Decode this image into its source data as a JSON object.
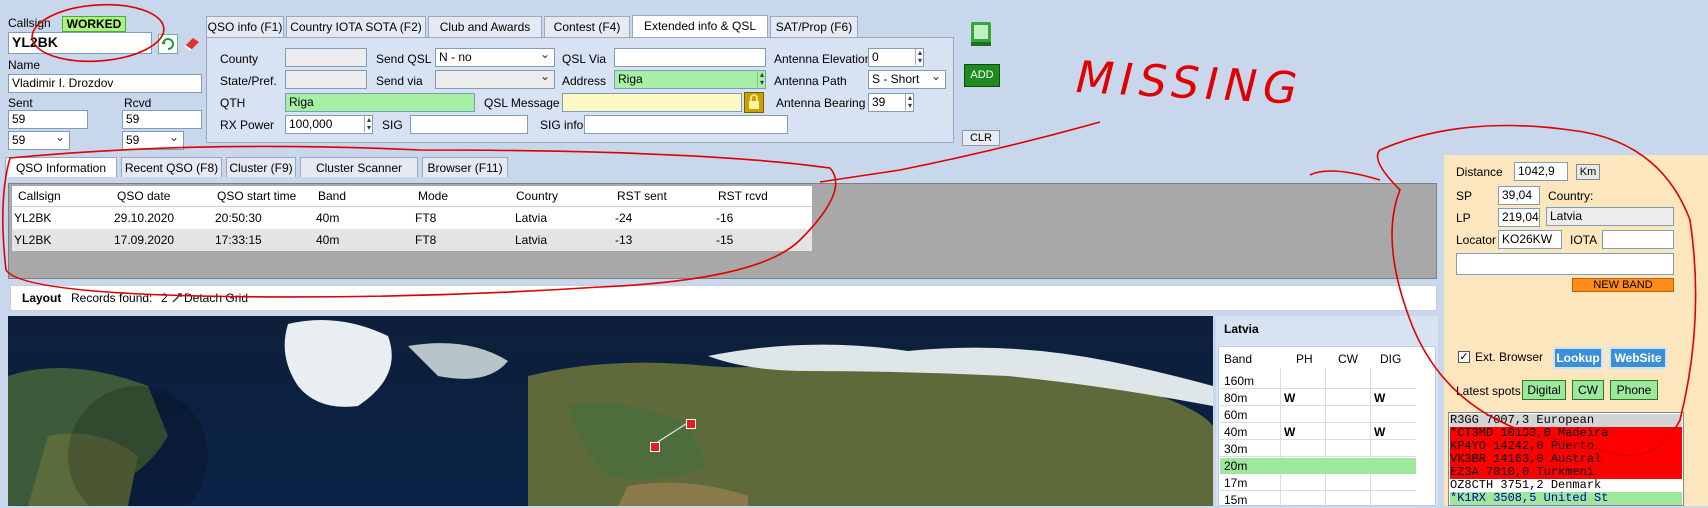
{
  "callsign_panel": {
    "callsign_label": "Callsign",
    "worked_badge": "WORKED",
    "callsign_value": "YL2BK",
    "name_label": "Name",
    "name_value": "Vladimir I. Drozdov",
    "sent_label": "Sent",
    "rcvd_label": "Rcvd",
    "sent_value": "59",
    "rcvd_value": "59",
    "sent_combo": "59",
    "rcvd_combo": "59"
  },
  "top_tabs": [
    "QSO info (F1)",
    "Country IOTA SOTA (F2)",
    "Club and Awards (F3)",
    "Contest (F4)",
    "Extended info & QSL (F5)",
    "SAT/Prop (F6)"
  ],
  "ext_form": {
    "county_label": "County",
    "state_label": "State/Pref.",
    "qth_label": "QTH",
    "qth_value": "Riga",
    "rx_power_label": "RX Power",
    "rx_power_value": "100,000",
    "send_qsl_label": "Send QSL",
    "send_qsl_value": "N - no",
    "send_via_label": "Send via",
    "qsl_message_label": "QSL Message",
    "sig_label": "SIG",
    "qsl_via_label": "QSL Via",
    "address_label": "Address",
    "address_value": "Riga",
    "sig_info_label": "SIG info",
    "antenna_elevation_label": "Antenna Elevation",
    "antenna_elevation_value": "0",
    "antenna_path_label": "Antenna Path",
    "antenna_path_value": "S - Short",
    "antenna_bearing_label": "Antenna Bearing",
    "antenna_bearing_value": "39"
  },
  "buttons": {
    "add": "ADD",
    "clr": "CLR"
  },
  "annotation": {
    "text": "MISSING"
  },
  "lower_tabs": [
    "QSO Information (F7)",
    "Recent QSO (F8)",
    "Cluster (F9)",
    "Cluster Scanner (F10)",
    "Browser (F11)"
  ],
  "qso_table": {
    "columns": [
      "Callsign",
      "QSO date",
      "QSO start time",
      "Band",
      "Mode",
      "Country",
      "RST sent",
      "RST rcvd"
    ],
    "rows": [
      [
        "YL2BK",
        "29.10.2020",
        "20:50:30",
        "40m",
        "FT8",
        "Latvia",
        "-24",
        "-16"
      ],
      [
        "YL2BK",
        "17.09.2020",
        "17:33:15",
        "40m",
        "FT8",
        "Latvia",
        "-13",
        "-15"
      ]
    ]
  },
  "grid_toolbar": {
    "layout": "Layout",
    "records_found": "Records found:",
    "records_count": "2",
    "detach": "Detach Grid"
  },
  "band_grid": {
    "country": "Latvia",
    "columns": [
      "Band",
      "PH",
      "CW",
      "DIG"
    ],
    "rows": [
      [
        "160m",
        "",
        "",
        ""
      ],
      [
        "80m",
        "W",
        "",
        "W"
      ],
      [
        "60m",
        "",
        "",
        ""
      ],
      [
        "40m",
        "W",
        "",
        "W"
      ],
      [
        "30m",
        "",
        "",
        ""
      ],
      [
        "20m",
        "",
        "",
        ""
      ],
      [
        "17m",
        "",
        "",
        ""
      ],
      [
        "15m",
        "",
        "",
        ""
      ]
    ],
    "highlight_color": "#9ee89e"
  },
  "right_panel": {
    "distance_label": "Distance",
    "distance_value": "1042,9",
    "distance_unit": "Km",
    "sp_label": "SP",
    "sp_value": "39,04",
    "lp_label": "LP",
    "lp_value": "219,04",
    "country_label": "Country:",
    "country_value": "Latvia",
    "locator_label": "Locator",
    "locator_value": "KO26KW",
    "iota_label": "IOTA",
    "new_band": "NEW BAND",
    "ext_browser_label": "Ext. Browser",
    "lookup": "Lookup",
    "website": "WebSite",
    "latest_spots_label": "Latest spots",
    "digital": "Digital",
    "cw": "CW",
    "phone": "Phone"
  },
  "spots": [
    {
      "text": " R3GG      7007,3 European",
      "bg": "#d4d4d4",
      "fg": "#000000"
    },
    {
      "text": "*CT3MD    10133,0 Madeira",
      "bg": "#ff0000",
      "fg": "#000000"
    },
    {
      "text": " KP4YO    14242,0 Puerto",
      "bg": "#ff0000",
      "fg": "#000000"
    },
    {
      "text": " VK3BR    14163,0 Austral",
      "bg": "#ff0000",
      "fg": "#000000"
    },
    {
      "text": " EZ3A      7010,0 Turkmeni",
      "bg": "#ff0000",
      "fg": "#000000"
    },
    {
      "text": " OZ8CTH    3751,2 Denmark",
      "bg": "#ffffff",
      "fg": "#000000"
    },
    {
      "text": "*K1RX      3508,5 United St",
      "bg": "#9ee89e",
      "fg": "#0000aa"
    }
  ],
  "colors": {
    "accent_green": "#1f8a1f",
    "worked_bg": "#aef27a",
    "annotation_red": "#e00000",
    "new_band_bg": "#ff8c1a",
    "lookup_bg": "#3a8fd6"
  }
}
